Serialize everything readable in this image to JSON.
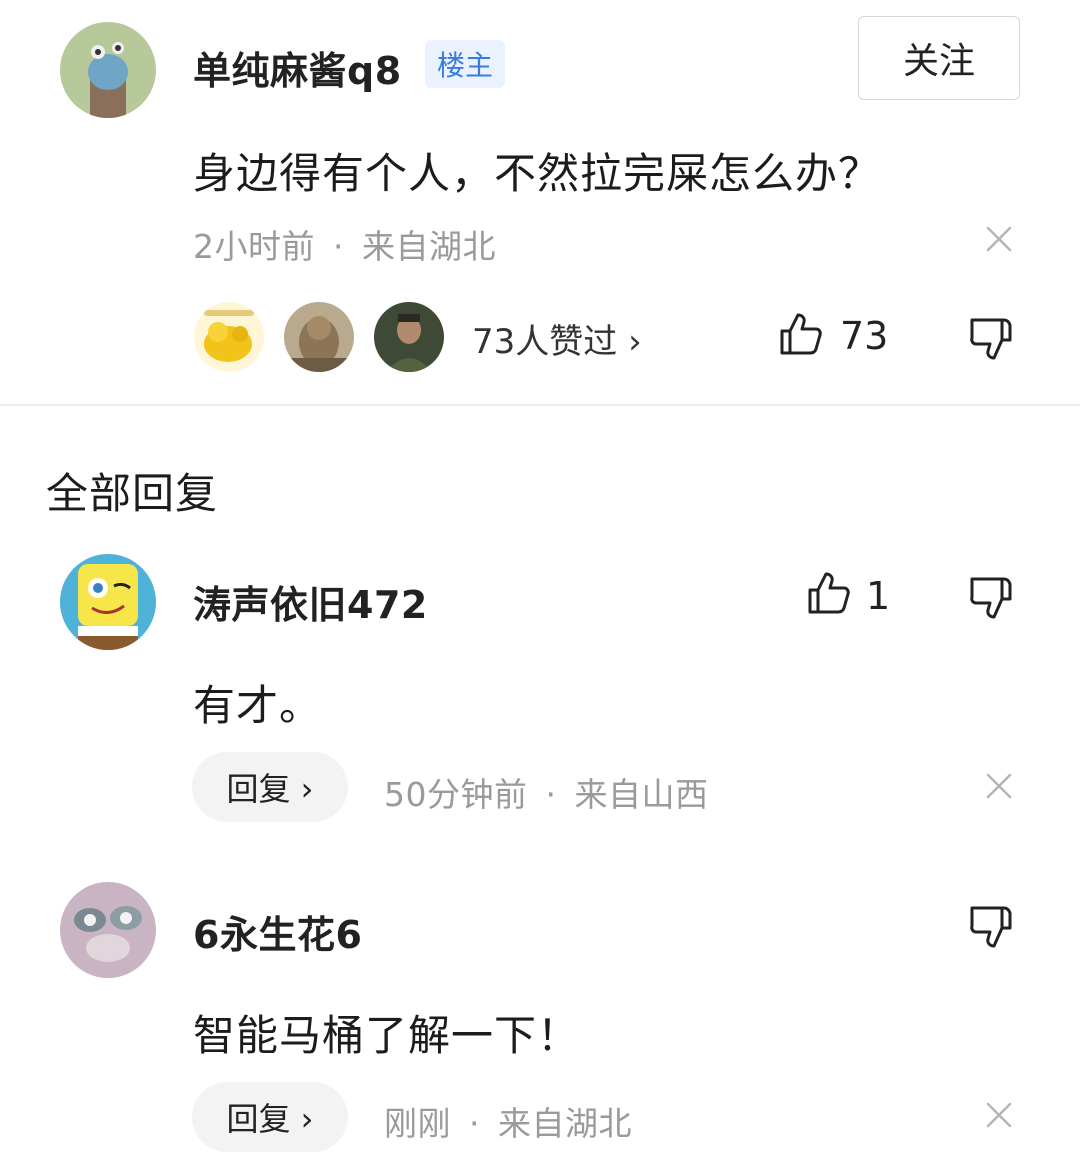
{
  "post": {
    "author": "单纯麻酱q8",
    "badge": "楼主",
    "follow_label": "关注",
    "content": "身边得有个人，不然拉完屎怎么办？",
    "time": "2小时前",
    "separator": "·",
    "location": "来自湖北",
    "likers_text": "73人赞过 ›",
    "like_count": "73"
  },
  "section_title": "全部回复",
  "replies": [
    {
      "author": "涛声依旧472",
      "content": "有才。",
      "reply_label": "回复 ›",
      "time": "50分钟前",
      "separator": "·",
      "location": "来自山西",
      "like_count": "1"
    },
    {
      "author": "6永生花6",
      "content": "智能马桶了解一下！",
      "reply_label": "回复 ›",
      "time": "刚刚",
      "separator": "·",
      "location": "来自湖北",
      "like_count": ""
    }
  ],
  "colors": {
    "badge_blue": "#3a7be0",
    "meta_gray": "#9a9a9a",
    "divider": "#ececec",
    "pill_bg": "#f3f3f3"
  },
  "icons": [
    "thumbs-up-icon",
    "thumbs-down-icon",
    "close-icon",
    "chevron-right-icon"
  ]
}
